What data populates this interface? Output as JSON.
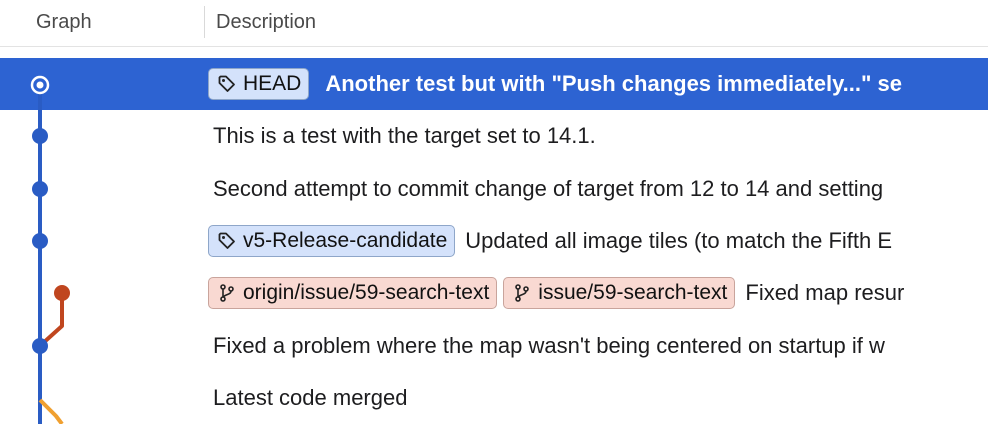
{
  "columns": {
    "graph": "Graph",
    "description": "Description"
  },
  "colors": {
    "selection": "#2d63d2",
    "main_line": "#2a5cc4",
    "branch_line": "#c0461f",
    "merge_line": "#f0a030",
    "tag_badge_bg": "#d4e2fb",
    "branch_badge_bg": "#f9d9d2"
  },
  "rows": [
    {
      "selected": true,
      "badges": [
        {
          "kind": "tag",
          "icon": "tag-icon",
          "label": "HEAD"
        }
      ],
      "message": "Another test but with \"Push changes immediately...\" se"
    },
    {
      "badges": [],
      "message": "This is a test with the target set to 14.1."
    },
    {
      "badges": [],
      "message": "Second attempt to commit change of target from 12 to 14 and setting"
    },
    {
      "badges": [
        {
          "kind": "tag",
          "icon": "tag-icon",
          "label": "v5-Release-candidate"
        }
      ],
      "message": "Updated all image tiles (to match the Fifth E"
    },
    {
      "badges": [
        {
          "kind": "branch",
          "icon": "branch-icon",
          "label": "origin/issue/59-search-text"
        },
        {
          "kind": "branch",
          "icon": "branch-icon",
          "label": "issue/59-search-text"
        }
      ],
      "message": "Fixed map resur"
    },
    {
      "badges": [],
      "message": "Fixed a problem where the map wasn't being centered on startup if w"
    },
    {
      "badges": [],
      "message": "Latest code merged"
    }
  ]
}
